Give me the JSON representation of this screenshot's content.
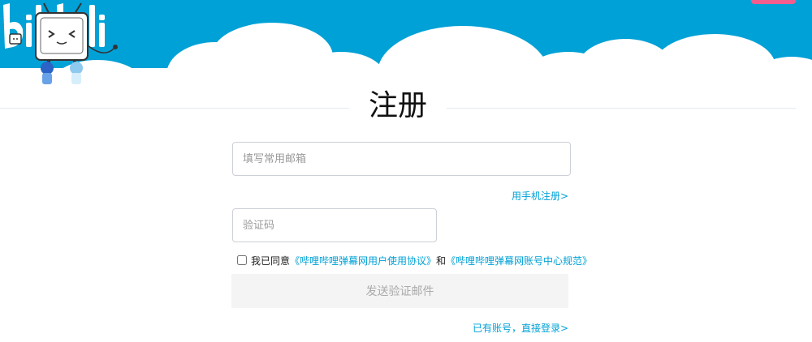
{
  "colors": {
    "header_blue": "#00a1d6",
    "link_blue": "#00a1d6",
    "brand_pink": "#f25d8e",
    "button_bg": "#f4f4f4",
    "button_text": "#aaaaaa",
    "border": "#ccd0d7"
  },
  "header": {
    "logo_text": "bilibili",
    "logo_icon": "bilibili-logo",
    "mascot_icon": "tv-mascot-illustration"
  },
  "page": {
    "title": "注册"
  },
  "form": {
    "email_placeholder": "填写常用邮箱",
    "phone_link": "用手机注册>",
    "code_placeholder": "验证码",
    "agree_prefix": "我已同意",
    "agree_link1": "《哔哩哔哩弹幕网用户使用协议》",
    "agree_and": "和",
    "agree_link2": "《哔哩哔哩弹幕网账号中心规范》",
    "agree_checked": false,
    "send_button": "发送验证邮件",
    "login_link": "已有账号，直接登录>"
  }
}
